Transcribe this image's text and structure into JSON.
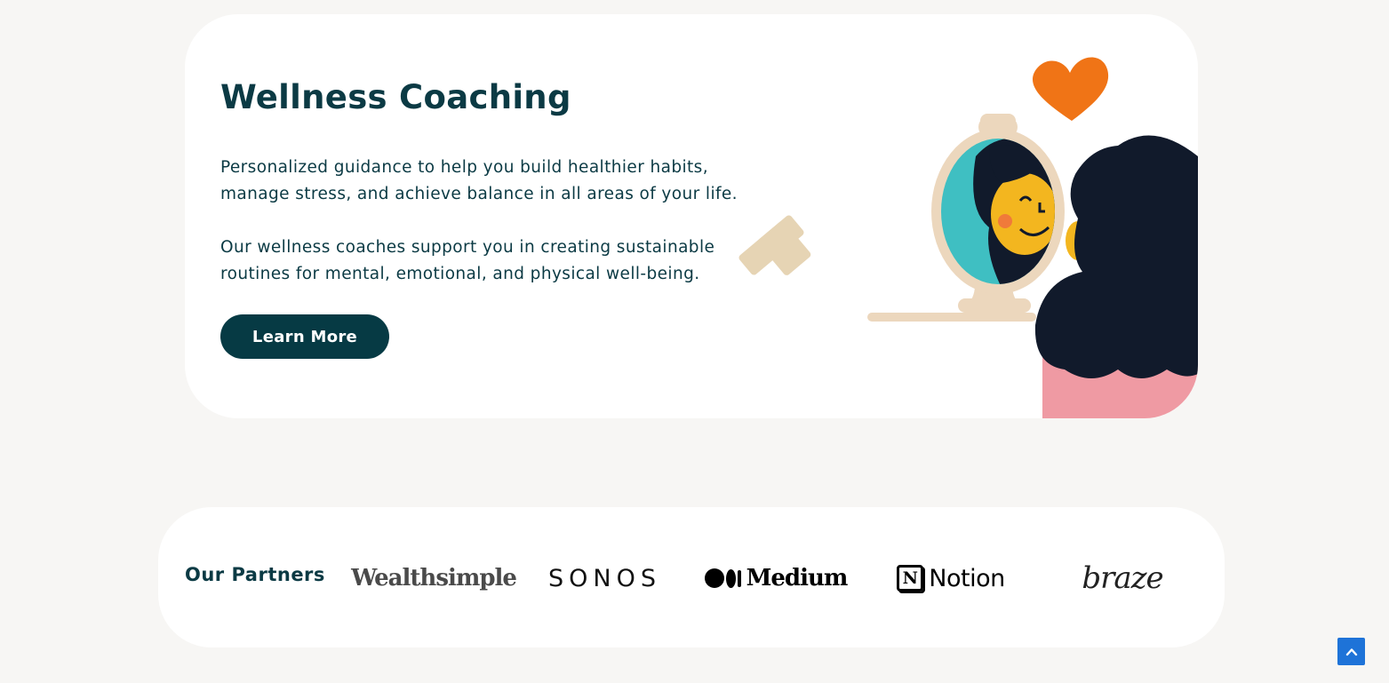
{
  "hero": {
    "title": "Wellness Coaching",
    "paragraph1": "Personalized guidance to help you build healthier habits, manage stress, and achieve balance in all areas of your life.",
    "paragraph2": "Our wellness coaches support you in creating sustainable routines for mental, emotional, and physical well-being.",
    "button_label": "Learn More",
    "illustration_icon": "woman-looking-in-mirror-with-heart-illustration",
    "colors": {
      "title": "#0b3a44",
      "button_bg": "#063a44",
      "heart": "#f07416",
      "hair": "#111a2b",
      "skin": "#f3b61f",
      "mirror_bg": "#3fbfc2",
      "mirror_frame": "#e9d6bb",
      "shirt": "#ef9aa3"
    }
  },
  "partners": {
    "label": "Our Partners",
    "logos": [
      {
        "name": "Wealthsimple",
        "text": "Wealthsimple"
      },
      {
        "name": "Sonos",
        "text": "SONOS"
      },
      {
        "name": "Medium",
        "text": "Medium"
      },
      {
        "name": "Notion",
        "text": "Notion",
        "mark": "N"
      },
      {
        "name": "Braze",
        "text": "braze"
      }
    ]
  },
  "scroll_top": {
    "icon": "chevron-up-icon",
    "color": "#1e73d8"
  }
}
